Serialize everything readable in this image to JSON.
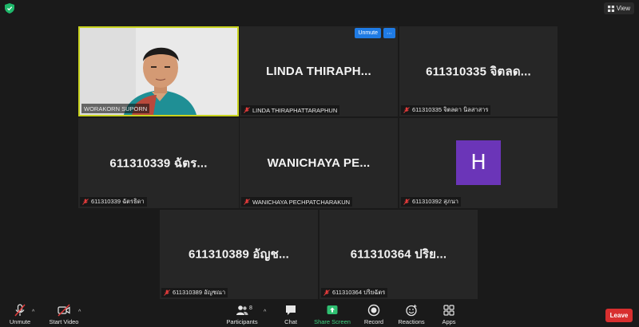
{
  "top_bar": {
    "view_label": "View"
  },
  "tiles": [
    {
      "small_name": "WORAKORN SUPORN"
    },
    {
      "big_name": "LINDA  THIRAPH...",
      "small_name": "LINDA THIRAPHATTARAPHUN",
      "unmute_label": "Unmute",
      "more_label": "⋯"
    },
    {
      "big_name": "611310335 จิตลด...",
      "small_name": "611310335 จิตลดา นิลสาสาร"
    },
    {
      "big_name": "611310339 ฉัตร...",
      "small_name": "611310339 ฉัตรธิดา"
    },
    {
      "big_name": "WANICHAYA  PE...",
      "small_name": "WANICHAYA PECHPATCHARAKUN"
    },
    {
      "avatar_letter": "H",
      "small_name": "611310392 สุภนา"
    },
    {
      "big_name": "611310389 อัญช...",
      "small_name": "611310389 อัญชณา"
    },
    {
      "big_name": "611310364 ปริย...",
      "small_name": "611310364 ปริยฉัตร"
    }
  ],
  "toolbar": {
    "unmute": "Unmute",
    "start_video": "Start Video",
    "participants": "Participants",
    "participants_count": "8",
    "chat": "Chat",
    "share_screen": "Share Screen",
    "record": "Record",
    "reactions": "Reactions",
    "apps": "Apps",
    "leave": "Leave"
  },
  "colors": {
    "active_speaker": "#c8d21e",
    "leave": "#d82f2f",
    "share": "#3fd17f",
    "avatar": "#6b35b8",
    "unmute": "#1f7be4"
  },
  "icons": [
    "shield-icon",
    "grid-icon",
    "muted-mic-icon",
    "video-off-icon",
    "participants-icon",
    "chat-icon",
    "share-screen-icon",
    "record-icon",
    "reactions-icon",
    "apps-icon"
  ]
}
